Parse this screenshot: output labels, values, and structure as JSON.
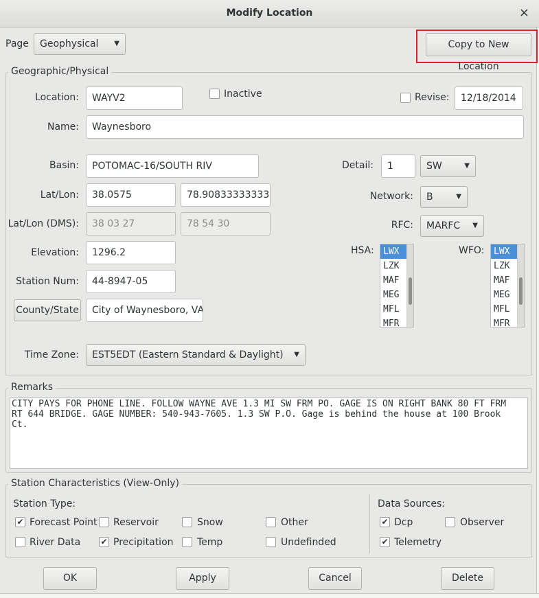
{
  "window": {
    "title": "Modify Location",
    "close": "×"
  },
  "page": {
    "label": "Page",
    "selected": "Geophysical"
  },
  "copy_button": "Copy to New Location",
  "geo": {
    "frame_title": "Geographic/Physical",
    "location_label": "Location:",
    "location": "WAYV2",
    "inactive_label": "Inactive",
    "inactive_checked": false,
    "revise_label": "Revise:",
    "revise_checked": false,
    "revise_date": "12/18/2014",
    "name_label": "Name:",
    "name": "Waynesboro",
    "basin_label": "Basin:",
    "basin": "POTOMAC-16/SOUTH RIV",
    "latlon_label": "Lat/Lon:",
    "lat": "38.0575",
    "lon": "78.908333333333",
    "dms_label": "Lat/Lon (DMS):",
    "lat_dms": "38 03 27",
    "lon_dms": "78 54 30",
    "elevation_label": "Elevation:",
    "elevation": "1296.2",
    "station_num_label": "Station Num:",
    "station_num": "44-8947-05",
    "county_button": "County/State",
    "county": "City of Waynesboro, VA",
    "timezone_label": "Time Zone:",
    "timezone": "EST5EDT  (Eastern  Standard & Daylight)",
    "detail_label": "Detail:",
    "detail": "1",
    "detail_dir": "SW",
    "network_label": "Network:",
    "network": "B",
    "rfc_label": "RFC:",
    "rfc": "MARFC",
    "hsa_label": "HSA:",
    "wfo_label": "WFO:",
    "offices": [
      "LWX",
      "LZK",
      "MAF",
      "MEG",
      "MFL",
      "MFR"
    ]
  },
  "remarks": {
    "frame_title": "Remarks",
    "text": "CITY PAYS FOR PHONE LINE. FOLLOW WAYNE AVE 1.3 MI SW FRM PO. GAGE IS ON RIGHT BANK 80 FT FRM\nRT 644 BRIDGE. GAGE NUMBER: 540-943-7605. 1.3 SW P.O. Gage is behind the house at 100 Brook\nCt."
  },
  "station": {
    "frame_title": "Station Characteristics (View-Only)",
    "type_label": "Station Type:",
    "types": [
      {
        "label": "Forecast Point",
        "checked": true
      },
      {
        "label": "Reservoir",
        "checked": false
      },
      {
        "label": "Snow",
        "checked": false
      },
      {
        "label": "Other",
        "checked": false
      },
      {
        "label": "River Data",
        "checked": false
      },
      {
        "label": "Precipitation",
        "checked": true
      },
      {
        "label": "Temp",
        "checked": false
      },
      {
        "label": "Undefinded",
        "checked": false
      }
    ],
    "sources_label": "Data Sources:",
    "sources": [
      {
        "label": "Dcp",
        "checked": true
      },
      {
        "label": "Observer",
        "checked": false
      },
      {
        "label": "Telemetry",
        "checked": true
      }
    ]
  },
  "buttons": {
    "ok": "OK",
    "apply": "Apply",
    "cancel": "Cancel",
    "delete": "Delete"
  },
  "colors": {
    "highlight": "#d9232d",
    "selection": "#4a90d9"
  }
}
